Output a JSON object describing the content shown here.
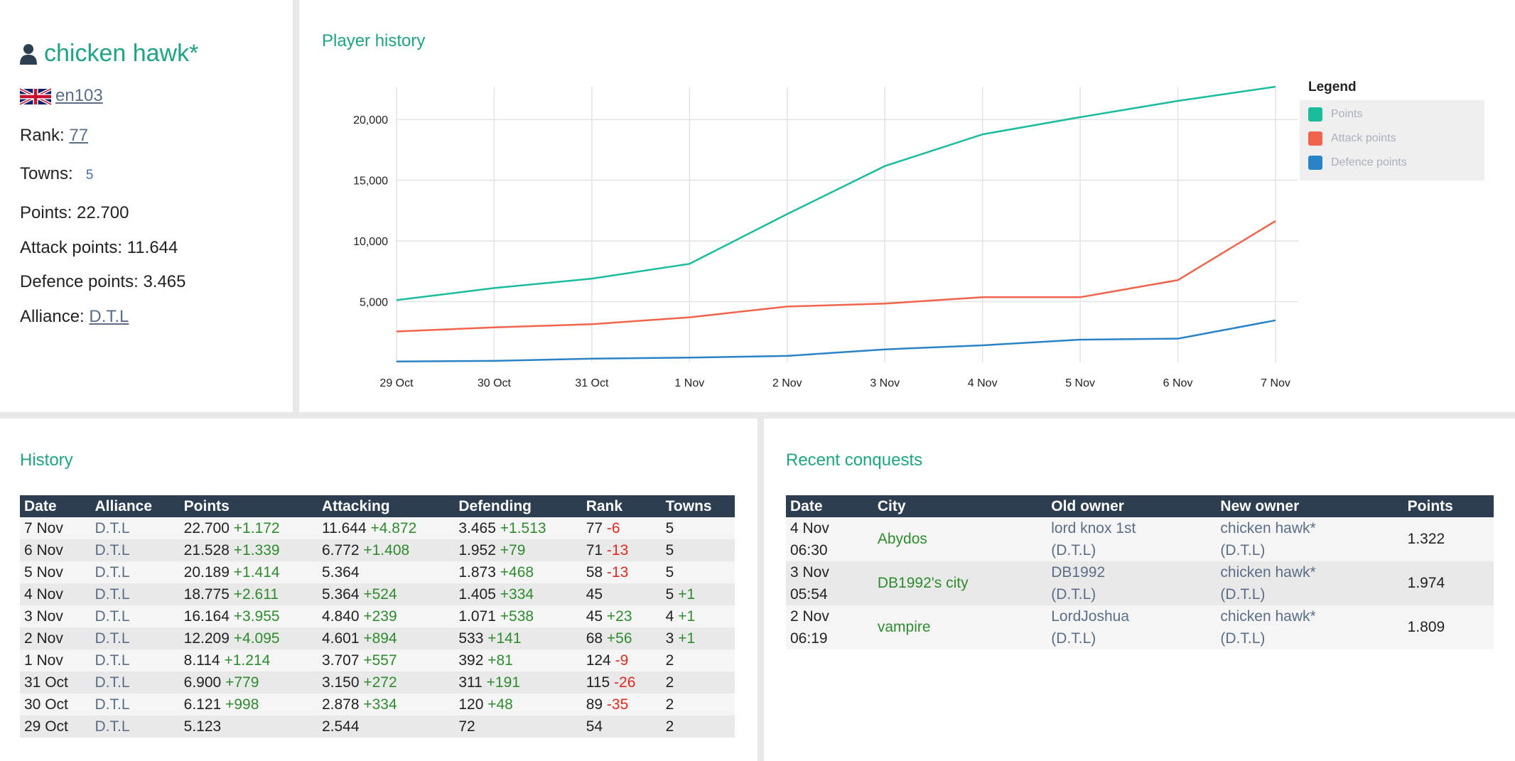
{
  "profile": {
    "name": "chicken hawk*",
    "world": "en103",
    "rank_label": "Rank:",
    "rank": "77",
    "towns_label": "Towns:",
    "towns": "5",
    "points_text": "Points: 22.700",
    "attack_text": "Attack points: 11.644",
    "defence_text": "Defence points: 3.465",
    "alliance_label": "Alliance:",
    "alliance": "D.T.L",
    "icons": {
      "user": "user-icon",
      "flag": "uk-flag-icon"
    }
  },
  "chart_card": {
    "title": "Player history",
    "legend_title": "Legend"
  },
  "chart_data": {
    "type": "line",
    "x": [
      "29 Oct",
      "30 Oct",
      "31 Oct",
      "1 Nov",
      "2 Nov",
      "3 Nov",
      "4 Nov",
      "5 Nov",
      "6 Nov",
      "7 Nov"
    ],
    "yticks": [
      5000,
      10000,
      15000,
      20000
    ],
    "ytick_labels": [
      "5,000",
      "10,000",
      "15,000",
      "20,000"
    ],
    "ylim": [
      0,
      22700
    ],
    "grid": true,
    "legend_position": "right",
    "series": [
      {
        "name": "Points",
        "color": "#1abc9c",
        "values": [
          5123,
          6121,
          6900,
          8114,
          12209,
          16164,
          18775,
          20189,
          21528,
          22700
        ]
      },
      {
        "name": "Attack points",
        "color": "#f0644b",
        "values": [
          2544,
          2878,
          3150,
          3707,
          4601,
          4840,
          5364,
          5364,
          6772,
          11644
        ]
      },
      {
        "name": "Defence points",
        "color": "#2a83c6",
        "values": [
          72,
          120,
          311,
          392,
          533,
          1071,
          1405,
          1873,
          1952,
          3465
        ]
      }
    ]
  },
  "history": {
    "title": "History",
    "columns": [
      "Date",
      "Alliance",
      "Points",
      "Attacking",
      "Defending",
      "Rank",
      "Towns"
    ],
    "rows": [
      {
        "date": "7 Nov",
        "alliance": "D.T.L",
        "points": "22.700",
        "points_d": "+1.172",
        "att": "11.644",
        "att_d": "+4.872",
        "def": "3.465",
        "def_d": "+1.513",
        "rank": "77",
        "rank_d": "-6",
        "towns": "5",
        "towns_d": ""
      },
      {
        "date": "6 Nov",
        "alliance": "D.T.L",
        "points": "21.528",
        "points_d": "+1.339",
        "att": "6.772",
        "att_d": "+1.408",
        "def": "1.952",
        "def_d": "+79",
        "rank": "71",
        "rank_d": "-13",
        "towns": "5",
        "towns_d": ""
      },
      {
        "date": "5 Nov",
        "alliance": "D.T.L",
        "points": "20.189",
        "points_d": "+1.414",
        "att": "5.364",
        "att_d": "",
        "def": "1.873",
        "def_d": "+468",
        "rank": "58",
        "rank_d": "-13",
        "towns": "5",
        "towns_d": ""
      },
      {
        "date": "4 Nov",
        "alliance": "D.T.L",
        "points": "18.775",
        "points_d": "+2.611",
        "att": "5.364",
        "att_d": "+524",
        "def": "1.405",
        "def_d": "+334",
        "rank": "45",
        "rank_d": "",
        "towns": "5",
        "towns_d": "+1"
      },
      {
        "date": "3 Nov",
        "alliance": "D.T.L",
        "points": "16.164",
        "points_d": "+3.955",
        "att": "4.840",
        "att_d": "+239",
        "def": "1.071",
        "def_d": "+538",
        "rank": "45",
        "rank_d": "+23",
        "towns": "4",
        "towns_d": "+1"
      },
      {
        "date": "2 Nov",
        "alliance": "D.T.L",
        "points": "12.209",
        "points_d": "+4.095",
        "att": "4.601",
        "att_d": "+894",
        "def": "533",
        "def_d": "+141",
        "rank": "68",
        "rank_d": "+56",
        "towns": "3",
        "towns_d": "+1"
      },
      {
        "date": "1 Nov",
        "alliance": "D.T.L",
        "points": "8.114",
        "points_d": "+1.214",
        "att": "3.707",
        "att_d": "+557",
        "def": "392",
        "def_d": "+81",
        "rank": "124",
        "rank_d": "-9",
        "towns": "2",
        "towns_d": ""
      },
      {
        "date": "31 Oct",
        "alliance": "D.T.L",
        "points": "6.900",
        "points_d": "+779",
        "att": "3.150",
        "att_d": "+272",
        "def": "311",
        "def_d": "+191",
        "rank": "115",
        "rank_d": "-26",
        "towns": "2",
        "towns_d": ""
      },
      {
        "date": "30 Oct",
        "alliance": "D.T.L",
        "points": "6.121",
        "points_d": "+998",
        "att": "2.878",
        "att_d": "+334",
        "def": "120",
        "def_d": "+48",
        "rank": "89",
        "rank_d": "-35",
        "towns": "2",
        "towns_d": ""
      },
      {
        "date": "29 Oct",
        "alliance": "D.T.L",
        "points": "5.123",
        "points_d": "",
        "att": "2.544",
        "att_d": "",
        "def": "72",
        "def_d": "",
        "rank": "54",
        "rank_d": "",
        "towns": "2",
        "towns_d": ""
      }
    ]
  },
  "conquests": {
    "title": "Recent conquests",
    "columns": [
      "Date",
      "City",
      "Old owner",
      "New owner",
      "Points"
    ],
    "rows": [
      {
        "date": "4 Nov",
        "time": "06:30",
        "city": "Abydos",
        "old_owner": "lord knox 1st",
        "old_alliance": "(D.T.L)",
        "new_owner": "chicken hawk*",
        "new_alliance": "(D.T.L)",
        "points": "1.322"
      },
      {
        "date": "3 Nov",
        "time": "05:54",
        "city": "DB1992's city",
        "old_owner": "DB1992",
        "old_alliance": "(D.T.L)",
        "new_owner": "chicken hawk*",
        "new_alliance": "(D.T.L)",
        "points": "1.974"
      },
      {
        "date": "2 Nov",
        "time": "06:19",
        "city": "vampire",
        "old_owner": "LordJoshua",
        "old_alliance": "(D.T.L)",
        "new_owner": "chicken hawk*",
        "new_alliance": "(D.T.L)",
        "points": "1.809"
      }
    ]
  }
}
